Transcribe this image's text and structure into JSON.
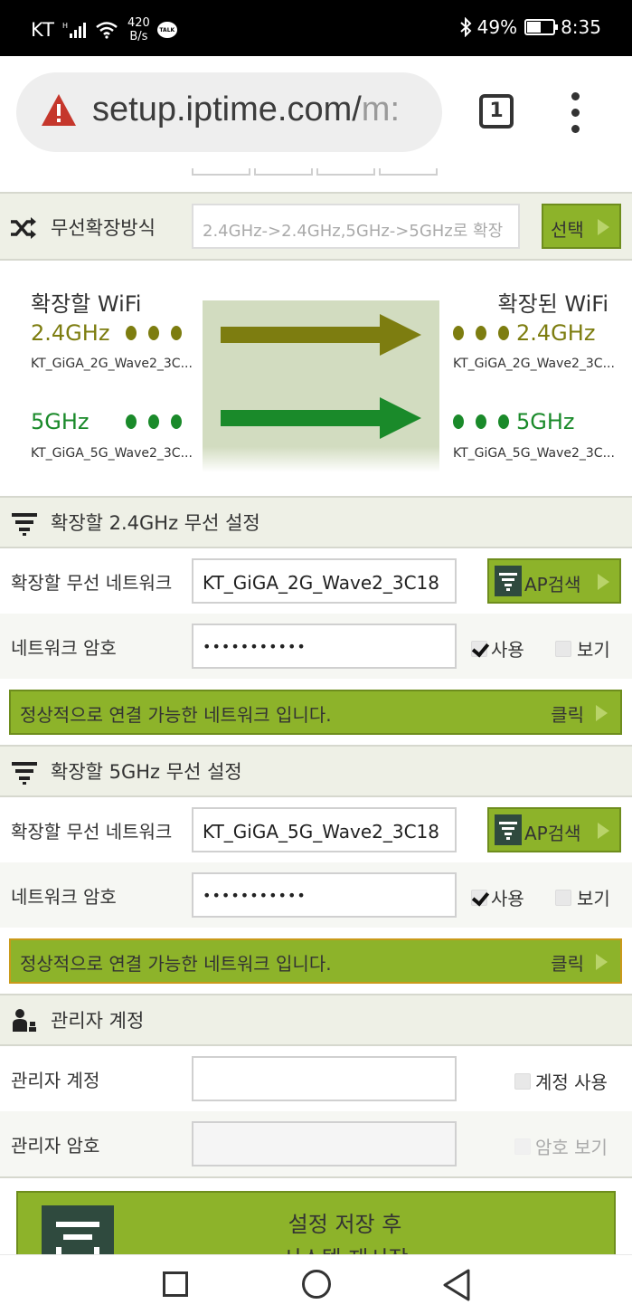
{
  "statusbar": {
    "carrier": "KT",
    "net_rate_value": "420",
    "net_rate_unit": "B/s",
    "talk_badge": "TALK",
    "battery": "49%",
    "time": "8:35",
    "battery_level": 0.49
  },
  "browser": {
    "url_main": "setup.iptime.com/",
    "url_faded": "m:",
    "tab_count": "1"
  },
  "extend_mode": {
    "label": "무선확장방식",
    "value": "2.4GHz->2.4GHz,5GHz->5GHz로 확장",
    "select_label": "선택"
  },
  "diagram": {
    "source_title": "확장할 WiFi",
    "target_title": "확장된 WiFi",
    "band_24": "2.4GHz",
    "band_5": "5GHz",
    "ssid_24": "KT_GiGA_2G_Wave2_3C...",
    "ssid_5": "KT_GiGA_5G_Wave2_3C...",
    "color_24": "#7d7d10",
    "color_5": "#1a8a2a"
  },
  "sec24": {
    "title": "확장할 2.4GHz 무선 설정",
    "network_label": "확장할 무선 네트워크",
    "network_value": "KT_GiGA_2G_Wave2_3C18",
    "ap_search": "AP검색",
    "password_label": "네트워크 암호",
    "password_value": "•••••••••••",
    "use_label": "사용",
    "show_label": "보기",
    "status_msg": "정상적으로 연결 가능한 네트워크 입니다.",
    "status_action": "클릭"
  },
  "sec5": {
    "title": "확장할 5GHz 무선 설정",
    "network_label": "확장할 무선 네트워크",
    "network_value": "KT_GiGA_5G_Wave2_3C18",
    "ap_search": "AP검색",
    "password_label": "네트워크 암호",
    "password_value": "•••••••••••",
    "use_label": "사용",
    "show_label": "보기",
    "status_msg": "정상적으로 연결 가능한 네트워크 입니다.",
    "status_action": "클릭"
  },
  "admin": {
    "title": "관리자 계정",
    "account_label": "관리자 계정",
    "account_value": "",
    "use_account_label": "계정 사용",
    "password_label": "관리자 암호",
    "password_value": "",
    "show_password_label": "암호 보기"
  },
  "save": {
    "line1": "설정 저장 후",
    "line2": "시스템 재시작"
  },
  "colors": {
    "accent_green": "#8db32a",
    "section_bg": "#eef0e6"
  }
}
